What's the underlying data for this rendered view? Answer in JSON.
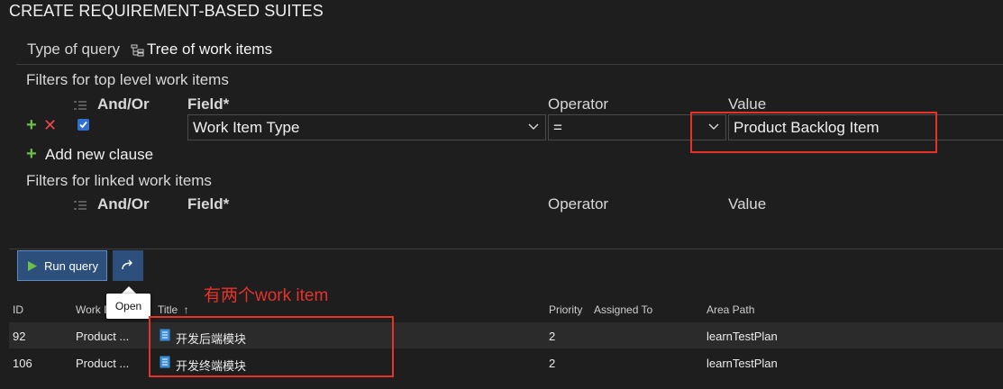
{
  "dialog": {
    "title": "CREATE REQUIREMENT-BASED SUITES"
  },
  "query_type": {
    "label": "Type of query",
    "value": "Tree of work items",
    "icon": "tree-query-icon"
  },
  "top_filters": {
    "header": "Filters for top level work items",
    "columns": {
      "andor": "And/Or",
      "field": "Field*",
      "operator": "Operator",
      "value": "Value"
    },
    "clauses": [
      {
        "checked": true,
        "field": "Work Item Type",
        "operator": "=",
        "value": "Product Backlog Item"
      }
    ],
    "add_clause": "Add new clause"
  },
  "linked_filters": {
    "header": "Filters for linked work items",
    "columns": {
      "andor": "And/Or",
      "field": "Field*",
      "operator": "Operator",
      "value": "Value"
    }
  },
  "toolbar": {
    "run_label": "Run query",
    "open_tooltip": "Open"
  },
  "annotation": "有两个work item",
  "results": {
    "columns": {
      "id": "ID",
      "work_item_type": "Work I",
      "title": "Title",
      "sort_indicator": "↑",
      "priority": "Priority",
      "assigned_to": "Assigned To",
      "area_path": "Area Path"
    },
    "rows": [
      {
        "id": "92",
        "type": "Product ...",
        "title": "开发后端模块",
        "priority": "2",
        "assigned_to": "",
        "area_path": "learnTestPlan"
      },
      {
        "id": "106",
        "type": "Product ...",
        "title": "开发终端模块",
        "priority": "2",
        "assigned_to": "",
        "area_path": "learnTestPlan"
      }
    ]
  },
  "colors": {
    "accent": "#2d4f7c",
    "highlight": "#e53427",
    "add": "#6cc04a",
    "delete": "#e8474c",
    "checkbox": "#2f6fd1"
  }
}
